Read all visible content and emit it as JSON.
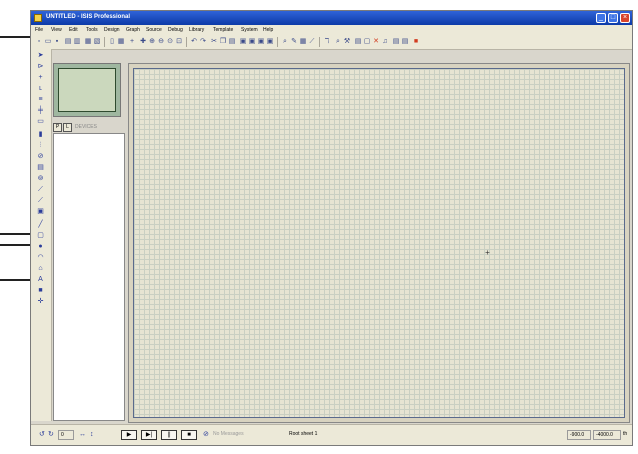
{
  "window": {
    "title": "UNTITLED - ISIS Professional",
    "minimize_label": "_",
    "maximize_label": "□",
    "close_label": "×"
  },
  "menu": {
    "items": [
      "File",
      "View",
      "Edit",
      "Tools",
      "Design",
      "Graph",
      "Source",
      "Debug",
      "Library",
      "Template",
      "System",
      "Help"
    ]
  },
  "toolbar": {
    "icons": [
      "new-file-icon",
      "open-file-icon",
      "save-icon",
      "import-icon",
      "export-icon",
      "print-icon",
      "print-area-icon",
      "refresh-icon",
      "grid-icon",
      "origin-icon",
      "pan-icon",
      "zoom-in-icon",
      "zoom-out-icon",
      "zoom-all-icon",
      "zoom-area-icon",
      "undo-icon",
      "redo-icon",
      "cut-icon",
      "copy-icon",
      "paste-icon",
      "block-copy-icon",
      "block-move-icon",
      "block-rotate-icon",
      "block-delete-icon",
      "pick-device-icon",
      "make-device-icon",
      "pcb-layout-icon",
      "decompose-icon",
      "wire-autorouter-icon",
      "search-icon",
      "property-tool-icon",
      "design-explorer-icon",
      "new-sheet-icon",
      "remove-sheet-icon",
      "netlist-icon",
      "bill-of-materials-icon",
      "electrical-check-icon",
      "ares-icon"
    ]
  },
  "left_tools": {
    "icons": [
      "selection-mode-icon",
      "component-mode-icon",
      "junction-dot-icon",
      "wire-label-icon",
      "text-script-icon",
      "buses-icon",
      "subcircuit-icon",
      "terminals-icon",
      "device-pins-icon",
      "graph-icon",
      "tape-recorder-icon",
      "generator-icon",
      "voltage-probe-icon",
      "current-probe-icon",
      "virtual-instruments-icon",
      "line-icon",
      "box-icon",
      "circle-icon",
      "arc-icon",
      "path-icon",
      "text-icon",
      "symbol-icon",
      "marker-icon"
    ]
  },
  "object_selector": {
    "pick_label": "P",
    "library_label": "L",
    "header_label": "DEVICES"
  },
  "statusbar": {
    "rotate_ccw": "↺",
    "rotate_cw": "↻",
    "angle_value": "0",
    "mirror_x": "↔",
    "mirror_y": "↕",
    "play_label": "▶",
    "step_label": "▶|",
    "pause_label": "||",
    "stop_label": "■",
    "messages_label": "No Messages",
    "sheet_label": "Root sheet 1",
    "coord_x": "-900.0",
    "coord_y": "-4000.0",
    "units": "th"
  },
  "colors": {
    "titlebar": "#1f4fc8",
    "chrome": "#ece9d8",
    "canvas_background": "#e6e4d2",
    "grid_line": "#c9cfc2",
    "sheet_border": "#5a6a8c",
    "overview_fill": "#cbd8bd"
  }
}
